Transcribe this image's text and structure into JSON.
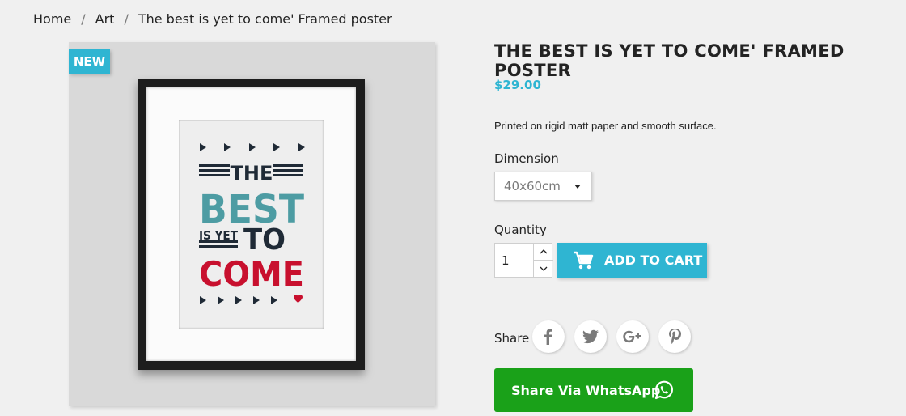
{
  "breadcrumb": {
    "items": [
      "Home",
      "Art",
      "The best is yet to come' Framed poster"
    ],
    "separator": "/"
  },
  "badge": {
    "label": "NEW"
  },
  "poster": {
    "line_the": "THE",
    "line_best": "BEST",
    "line_isyet": "IS YET",
    "line_to": "TO",
    "line_come": "COME",
    "colors": {
      "teal": "#4d9ca3",
      "red": "#c8102e",
      "dark": "#1f2a36"
    }
  },
  "product": {
    "title": "THE BEST IS YET TO COME' FRAMED POSTER",
    "price": "$29.00",
    "description": "Printed on rigid matt paper and smooth surface.",
    "dimension_label": "Dimension",
    "dimension_value": "40x60cm",
    "quantity_label": "Quantity",
    "quantity_value": "1",
    "add_to_cart": "ADD TO CART",
    "share_label": "Share",
    "social": [
      "facebook-icon",
      "twitter-icon",
      "google-plus-icon",
      "pinterest-icon"
    ],
    "whatsapp": "Share Via WhatsApp"
  },
  "colors": {
    "accent": "#2fb5d2",
    "whatsapp": "#1aa119",
    "background": "#f0f0f0"
  }
}
